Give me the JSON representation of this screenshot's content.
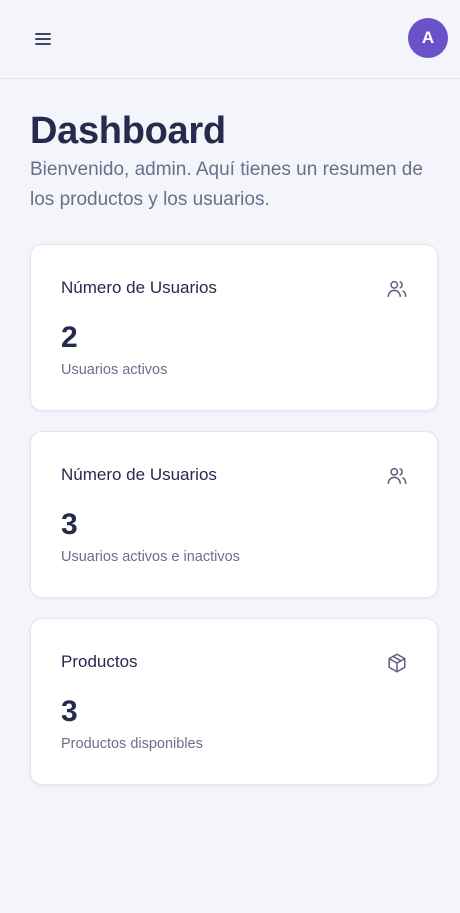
{
  "header": {
    "menu_icon": "hamburger-menu-icon",
    "avatar_initial": "A",
    "avatar_color": "#6b52c9"
  },
  "page": {
    "title": "Dashboard",
    "subtitle": "Bienvenido, admin. Aquí tienes un resumen de los productos y los usuarios."
  },
  "cards": [
    {
      "title": "Número de Usuarios",
      "value": "2",
      "description": "Usuarios activos",
      "icon": "users-icon"
    },
    {
      "title": "Número de Usuarios",
      "value": "3",
      "description": "Usuarios activos e inactivos",
      "icon": "users-icon"
    },
    {
      "title": "Productos",
      "value": "3",
      "description": "Productos disponibles",
      "icon": "package-icon"
    }
  ]
}
